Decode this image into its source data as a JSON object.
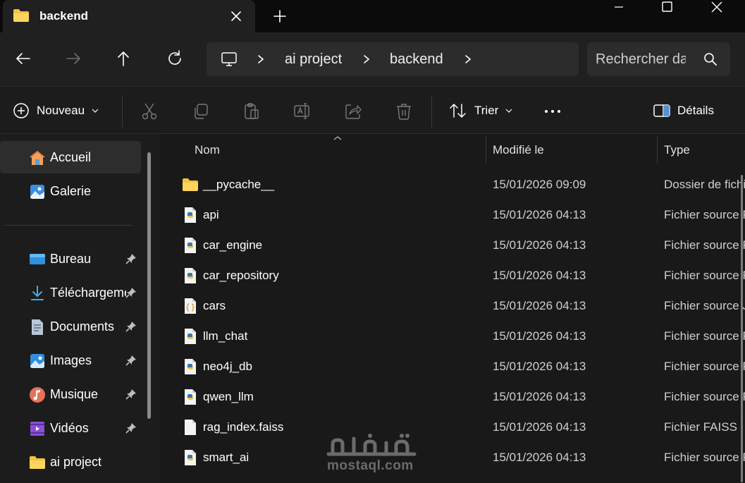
{
  "window": {
    "tab_title": "backend"
  },
  "address": {
    "breadcrumbs": [
      "ai project",
      "backend"
    ],
    "search_placeholder": "Rechercher dans backend"
  },
  "commands": {
    "new_label": "Nouveau",
    "sort_label": "Trier",
    "details_label": "Détails"
  },
  "sidebar": {
    "items": [
      {
        "label": "Accueil",
        "icon": "home-icon"
      },
      {
        "label": "Galerie",
        "icon": "gallery-icon"
      },
      {
        "label": "Bureau",
        "icon": "desktop-icon"
      },
      {
        "label": "Téléchargements",
        "icon": "downloads-icon"
      },
      {
        "label": "Documents",
        "icon": "documents-icon"
      },
      {
        "label": "Images",
        "icon": "images-icon"
      },
      {
        "label": "Musique",
        "icon": "music-icon"
      },
      {
        "label": "Vidéos",
        "icon": "videos-icon"
      },
      {
        "label": "ai project",
        "icon": "folder-icon"
      }
    ]
  },
  "columns": {
    "name": "Nom",
    "modified": "Modifié le",
    "type": "Type"
  },
  "files": [
    {
      "name": "__pycache__",
      "modified": "15/01/2026 09:09",
      "type": "Dossier de fichiers",
      "icon": "folder-icon"
    },
    {
      "name": "api",
      "modified": "15/01/2026 04:13",
      "type": "Fichier source Python",
      "icon": "python-file-icon"
    },
    {
      "name": "car_engine",
      "modified": "15/01/2026 04:13",
      "type": "Fichier source Python",
      "icon": "python-file-icon"
    },
    {
      "name": "car_repository",
      "modified": "15/01/2026 04:13",
      "type": "Fichier source Python",
      "icon": "python-file-icon"
    },
    {
      "name": "cars",
      "modified": "15/01/2026 04:13",
      "type": "Fichier source JSON",
      "icon": "json-file-icon"
    },
    {
      "name": "llm_chat",
      "modified": "15/01/2026 04:13",
      "type": "Fichier source Python",
      "icon": "python-file-icon"
    },
    {
      "name": "neo4j_db",
      "modified": "15/01/2026 04:13",
      "type": "Fichier source Python",
      "icon": "python-file-icon"
    },
    {
      "name": "qwen_llm",
      "modified": "15/01/2026 04:13",
      "type": "Fichier source Python",
      "icon": "python-file-icon"
    },
    {
      "name": "rag_index.faiss",
      "modified": "15/01/2026 04:13",
      "type": "Fichier FAISS",
      "icon": "blank-file-icon"
    },
    {
      "name": "smart_ai",
      "modified": "15/01/2026 04:13",
      "type": "Fichier source Python",
      "icon": "python-file-icon"
    }
  ],
  "watermark": {
    "text": "mostaql.com"
  }
}
